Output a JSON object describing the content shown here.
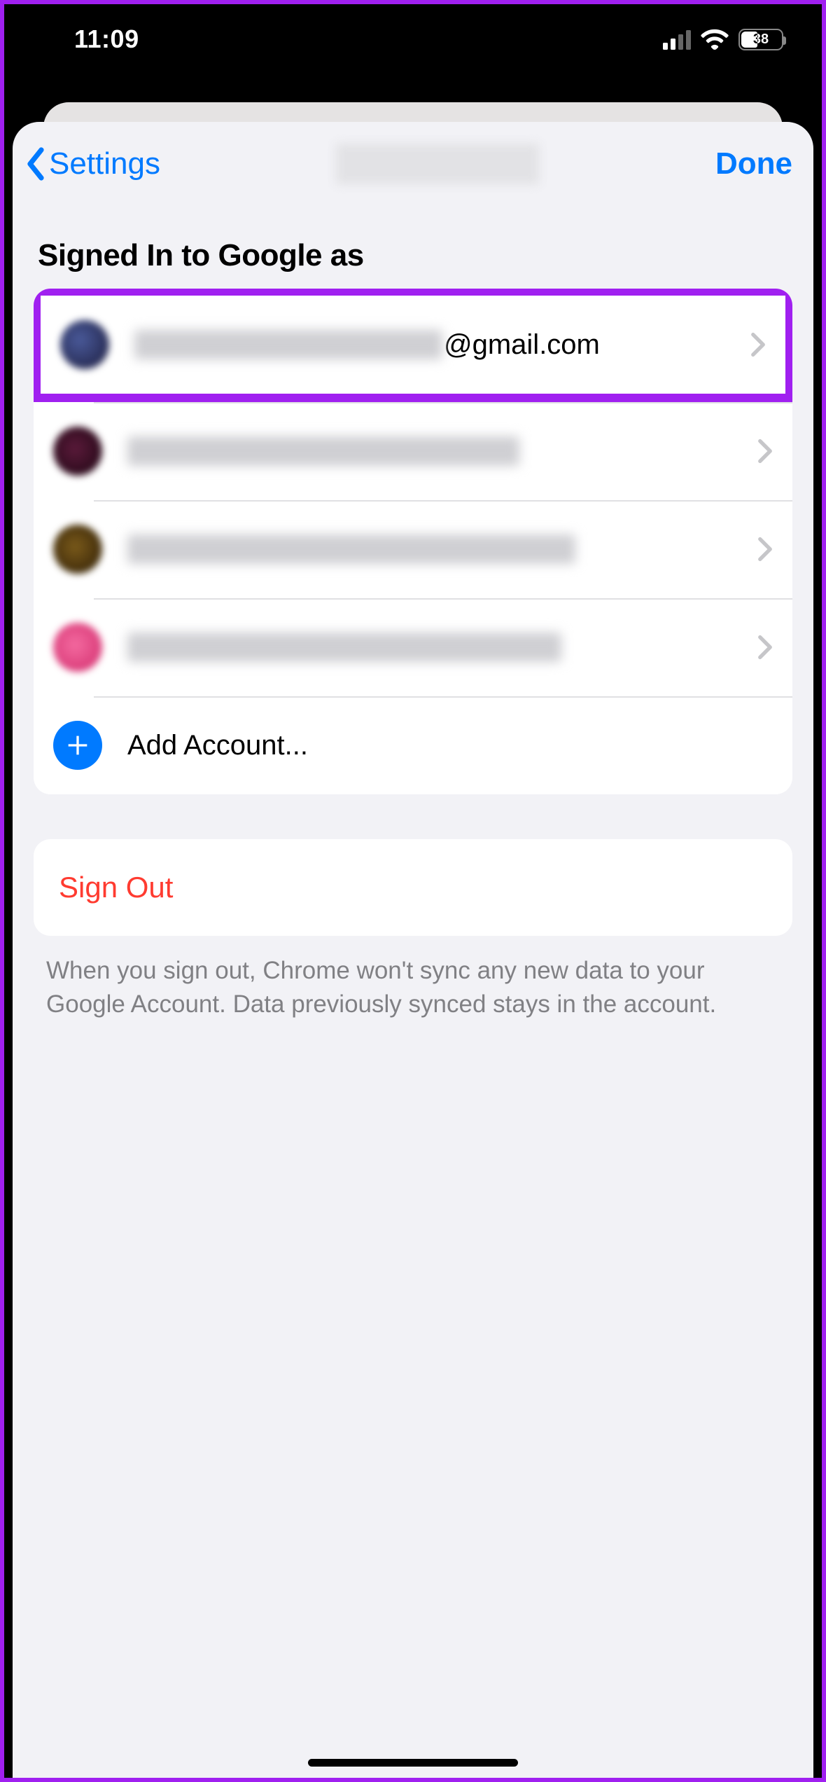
{
  "status_bar": {
    "time": "11:09",
    "battery_percent": "38"
  },
  "navbar": {
    "back_label": "Settings",
    "done_label": "Done"
  },
  "section": {
    "header": "Signed In to Google as",
    "accounts": [
      {
        "email_visible_part": "@gmail.com",
        "avatar_color": "#2a3a6a"
      },
      {
        "email_visible_part": "",
        "avatar_color": "#3a0f22"
      },
      {
        "email_visible_part": "",
        "avatar_color": "#4a3a10"
      },
      {
        "email_visible_part": "",
        "avatar_color": "#e6457e"
      }
    ],
    "add_account_label": "Add Account..."
  },
  "sign_out": {
    "label": "Sign Out",
    "footer": "When you sign out, Chrome won't sync any new data to your Google Account. Data previously synced stays in the account."
  },
  "colors": {
    "accent": "#007aff",
    "destructive": "#ff3b30",
    "highlight": "#a020f0"
  }
}
